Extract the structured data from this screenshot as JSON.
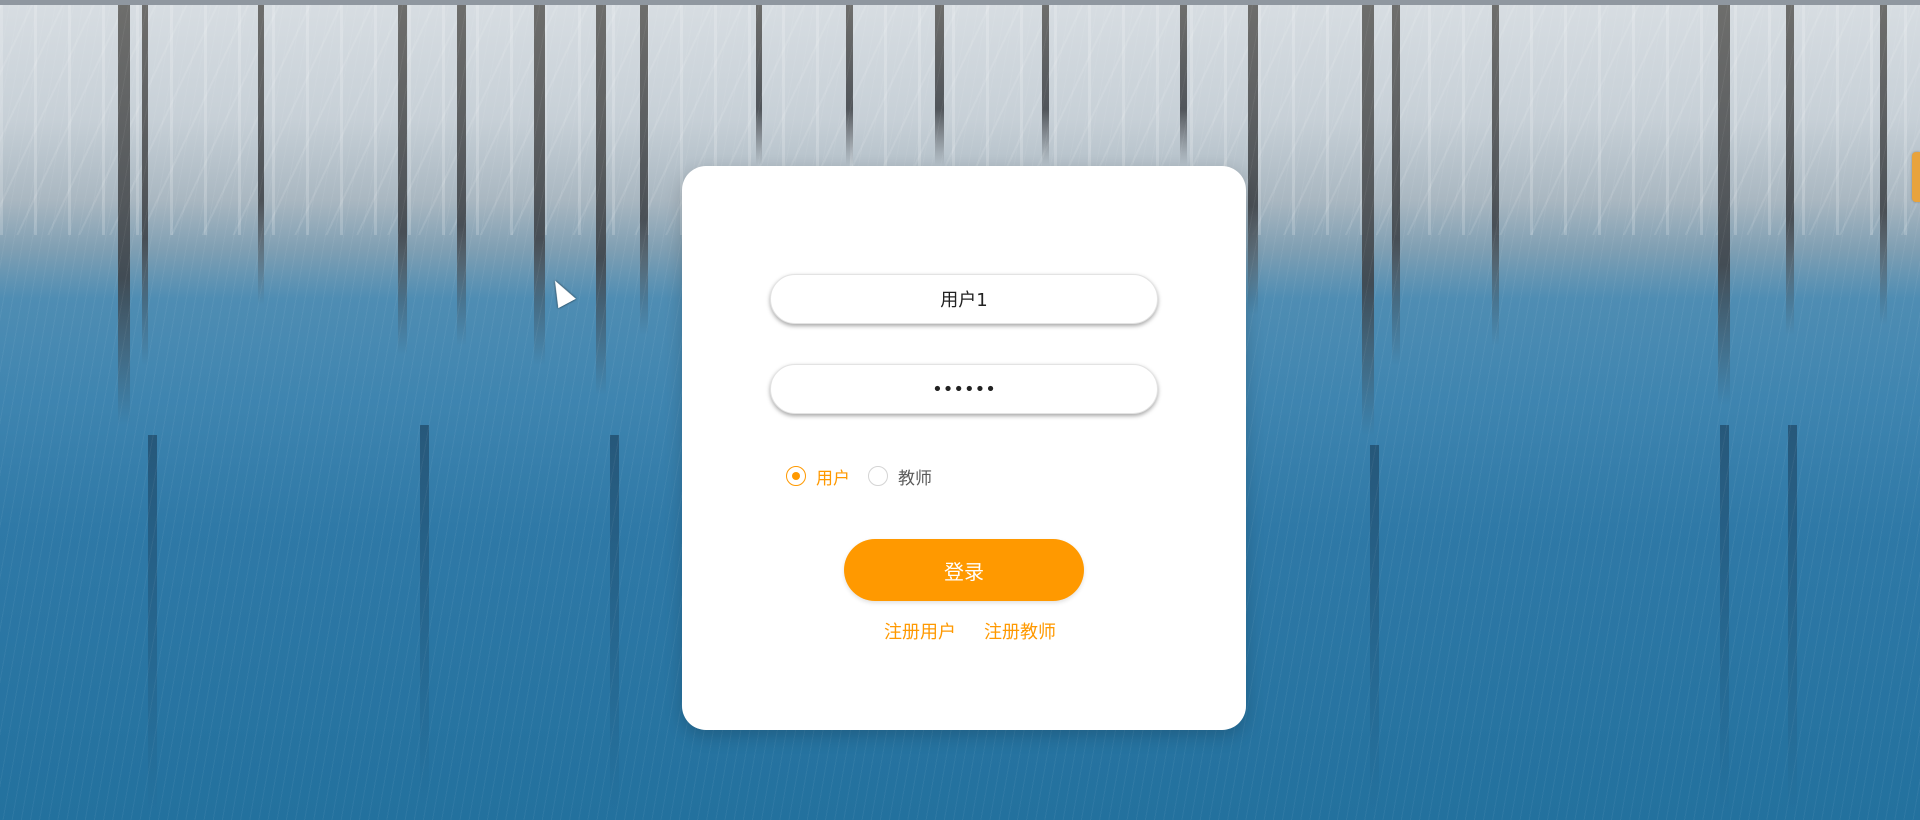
{
  "login": {
    "username_value": "用户1",
    "password_value": "••••••",
    "role_options": [
      {
        "label": "用户",
        "selected": true
      },
      {
        "label": "教师",
        "selected": false
      }
    ],
    "login_button": "登录",
    "links": [
      "注册用户",
      "注册教师"
    ]
  },
  "colors": {
    "accent": "#ff9900",
    "card_bg": "#ffffff"
  },
  "icons": {
    "cursor": "mouse-pointer-icon"
  }
}
